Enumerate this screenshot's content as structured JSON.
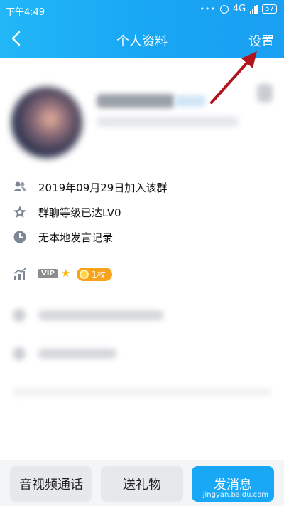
{
  "status_bar": {
    "time": "下午4:49",
    "network": "4G",
    "battery": "57"
  },
  "nav": {
    "title": "个人资料",
    "settings": "设置"
  },
  "info": [
    {
      "icon": "group-icon",
      "text": "2019年09月29日加入该群"
    },
    {
      "icon": "star-level-icon",
      "text": "群聊等级已达LV0"
    },
    {
      "icon": "clock-icon",
      "text": "无本地发言记录"
    }
  ],
  "vip": {
    "tag": "VIP",
    "badge": "1枚"
  },
  "bottom_bar": {
    "call": "音视频通话",
    "gift": "送礼物",
    "message": "发消息",
    "watermark": "jingyan.baidu.com"
  },
  "colors": {
    "header": "#19a8f5",
    "badge": "#f7a21b",
    "arrow": "#b0141c"
  }
}
